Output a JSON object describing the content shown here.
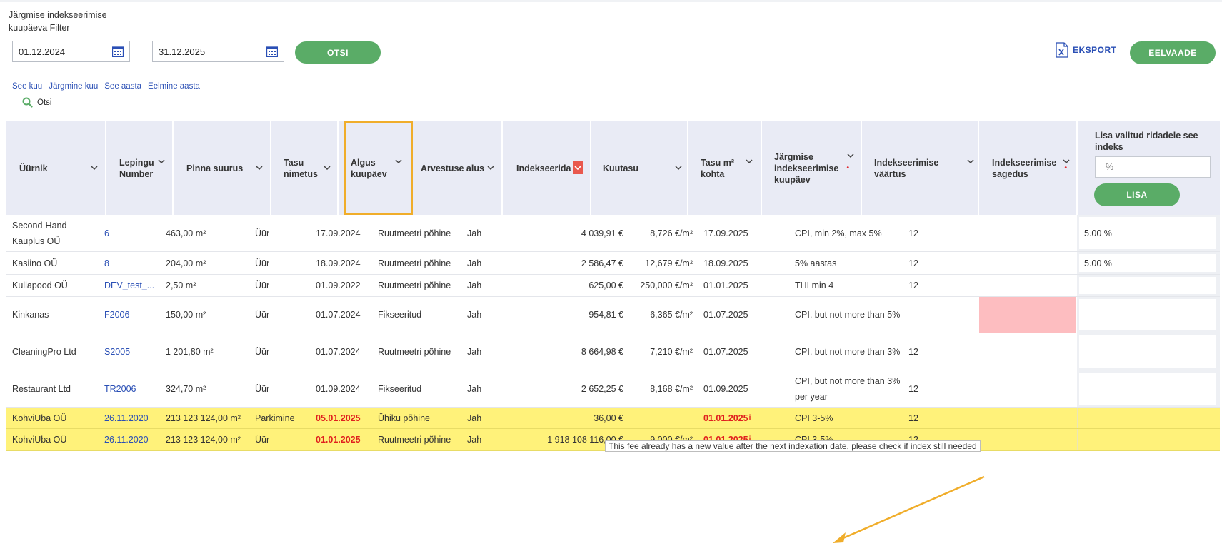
{
  "filter": {
    "title": "Järgmise indekseerimise kuupäeva Filter",
    "date_from": "01.12.2024",
    "date_to": "31.12.2025",
    "search_button": "OTSI",
    "quick_links": [
      "See kuu",
      "Järgmine kuu",
      "See aasta",
      "Eelmine aasta"
    ],
    "search_link": "Otsi"
  },
  "toolbar": {
    "export_label": "EKSPORT",
    "preview_button": "EELVAADE"
  },
  "table": {
    "columns": [
      {
        "label": "Üürnik"
      },
      {
        "label": "Lepingu Number"
      },
      {
        "label": "Pinna suurus"
      },
      {
        "label": "Tasu nimetus"
      },
      {
        "label": "Algus kuupäev"
      },
      {
        "label": "Arvestuse alus"
      },
      {
        "label": "Indekseerida"
      },
      {
        "label": "Kuutasu"
      },
      {
        "label": "Tasu m² kohta"
      },
      {
        "label": "Järgmise indekseerimise kuupäev"
      },
      {
        "label": "Indekseerimise väärtus"
      },
      {
        "label": "Indekseerimise sagedus"
      }
    ],
    "bulk": {
      "label": "Lisa valitud ridadele see indeks",
      "placeholder": "%",
      "button": "LISA"
    },
    "rows": [
      {
        "tenant": "Second-Hand Kauplus OÜ",
        "contract": "6",
        "area": "463,00 m²",
        "fee_name": "Üür",
        "start": "17.09.2024",
        "basis": "Ruutmeetri põhine",
        "index": "Jah",
        "monthly": "4 039,91 €",
        "per_m2": "8,726 €/m²",
        "next_date": "17.09.2025",
        "index_value": "CPI, min 2%, max 5%",
        "frequency": "12",
        "added_index": "5.00 %"
      },
      {
        "tenant": "Kasiino OÜ",
        "contract": "8",
        "area": "204,00 m²",
        "fee_name": "Üür",
        "start": "18.09.2024",
        "basis": "Ruutmeetri põhine",
        "index": "Jah",
        "monthly": "2 586,47 €",
        "per_m2": "12,679 €/m²",
        "next_date": "18.09.2025",
        "index_value": "5% aastas",
        "frequency": "12",
        "added_index": "5.00 %"
      },
      {
        "tenant": "Kullapood OÜ",
        "contract": "DEV_test_...",
        "area": "2,50 m²",
        "fee_name": "Üür",
        "start": "01.09.2022",
        "basis": "Ruutmeetri põhine",
        "index": "Jah",
        "monthly": "625,00 €",
        "per_m2": "250,000 €/m²",
        "next_date": "01.01.2025",
        "index_value": "THI min 4",
        "frequency": "12",
        "added_index": ""
      },
      {
        "tenant": "Kinkanas",
        "contract": "F2006",
        "area": "150,00 m²",
        "fee_name": "Üür",
        "start": "01.07.2024",
        "basis": "Fikseeritud",
        "index": "Jah",
        "monthly": "954,81 €",
        "per_m2": "6,365 €/m²",
        "next_date": "01.07.2025",
        "index_value": "CPI, but not more than 5%",
        "frequency": "",
        "added_index": ""
      },
      {
        "tenant": "CleaningPro Ltd",
        "contract": "S2005",
        "area": "1 201,80 m²",
        "fee_name": "Üür",
        "start": "01.07.2024",
        "basis": "Ruutmeetri põhine",
        "index": "Jah",
        "monthly": "8 664,98 €",
        "per_m2": "7,210 €/m²",
        "next_date": "01.07.2025",
        "index_value": "CPI, but not more than 3%",
        "frequency": "12",
        "added_index": ""
      },
      {
        "tenant": "Restaurant Ltd",
        "contract": "TR2006",
        "area": "324,70 m²",
        "fee_name": "Üür",
        "start": "01.09.2024",
        "basis": "Fikseeritud",
        "index": "Jah",
        "monthly": "2 652,25 €",
        "per_m2": "8,168 €/m²",
        "next_date": "01.09.2025",
        "index_value": "CPI, but not more than 3% per year",
        "frequency": "12",
        "added_index": ""
      },
      {
        "tenant": "KohviUba OÜ",
        "contract": "26.11.2020",
        "area": "213 123 124,00 m²",
        "fee_name": "Parkimine",
        "start": "05.01.2025",
        "basis": "Ühiku põhine",
        "index": "Jah",
        "monthly": "36,00 €",
        "per_m2": "",
        "next_date": "01.01.2025",
        "index_value": "CPI 3-5%",
        "frequency": "12",
        "added_index": ""
      },
      {
        "tenant": "KohviUba OÜ",
        "contract": "26.11.2020",
        "area": "213 123 124,00 m²",
        "fee_name": "Üür",
        "start": "01.01.2025",
        "basis": "Ruutmeetri põhine",
        "index": "Jah",
        "monthly": "1 918 108 116,00 €",
        "per_m2": "9,000 €/m²",
        "next_date": "01.01.2025",
        "index_value": "CPI 3-5%",
        "frequency": "12",
        "added_index": ""
      }
    ],
    "info_marker": "i",
    "tooltip": "This fee already has a new value after the next indexation date, please check if index still needed"
  },
  "colors": {
    "accent_green": "#5aac67",
    "link_blue": "#2a4fb5",
    "header_bg": "#e9ebf5",
    "warning_yellow": "#fff27a",
    "error_pink": "#fdbdc0",
    "highlight_orange": "#f0ad2a",
    "alert_red": "#e0201e"
  },
  "icons": {
    "calendar": "calendar-icon",
    "export": "excel-export-icon",
    "search": "search-icon",
    "sort": "chevron-down-icon"
  }
}
